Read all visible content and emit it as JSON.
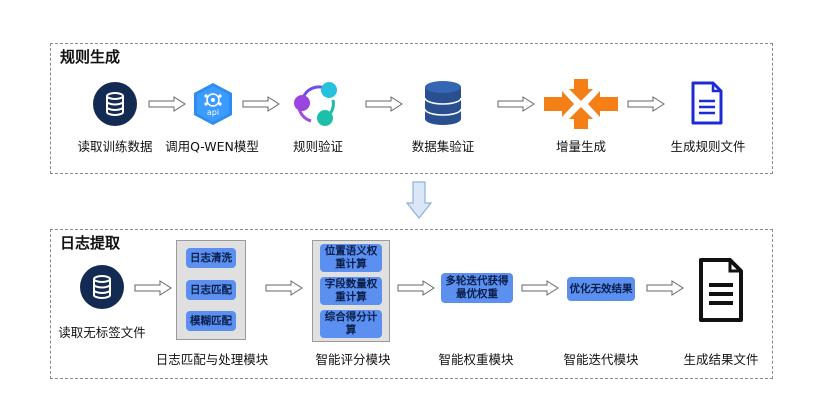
{
  "colors": {
    "navy": "#132a52",
    "blue_box": "#5b8ff0",
    "orange": "#f47f16",
    "doc_blue": "#1d2bd6",
    "panel_gray": "#e0e0e0"
  },
  "top_section": {
    "title": "规则生成",
    "steps": [
      {
        "label": "读取训练数据",
        "icon": "database-icon"
      },
      {
        "label": "调用Q-WEN模型",
        "icon": "api-hexagon-icon"
      },
      {
        "label": "规则验证",
        "icon": "ring-nodes-icon"
      },
      {
        "label": "数据集验证",
        "icon": "database-cylinder-icon"
      },
      {
        "label": "增量生成",
        "icon": "converging-arrows-icon"
      },
      {
        "label": "生成规则文件",
        "icon": "document-icon"
      }
    ],
    "api_text": "api"
  },
  "bottom_section": {
    "title": "日志提取",
    "input_label": "读取无标签文件",
    "module1": {
      "label": "日志匹配与处理模块",
      "items": [
        "日志清洗",
        "日志匹配",
        "模糊匹配"
      ]
    },
    "module2": {
      "label": "智能评分模块",
      "items": [
        {
          "line1": "位置语义权",
          "line2": "重计算"
        },
        {
          "line1": "字段数量权",
          "line2": "重计算"
        },
        {
          "line1": "综合得分计",
          "line2": "算"
        }
      ]
    },
    "module3": {
      "label": "智能权重模块",
      "line1": "多轮迭代获得",
      "line2": "最优权重"
    },
    "module4": {
      "label": "智能迭代模块",
      "text": "优化无效结果"
    },
    "output": {
      "label": "生成结果文件",
      "icon": "document-icon"
    }
  }
}
